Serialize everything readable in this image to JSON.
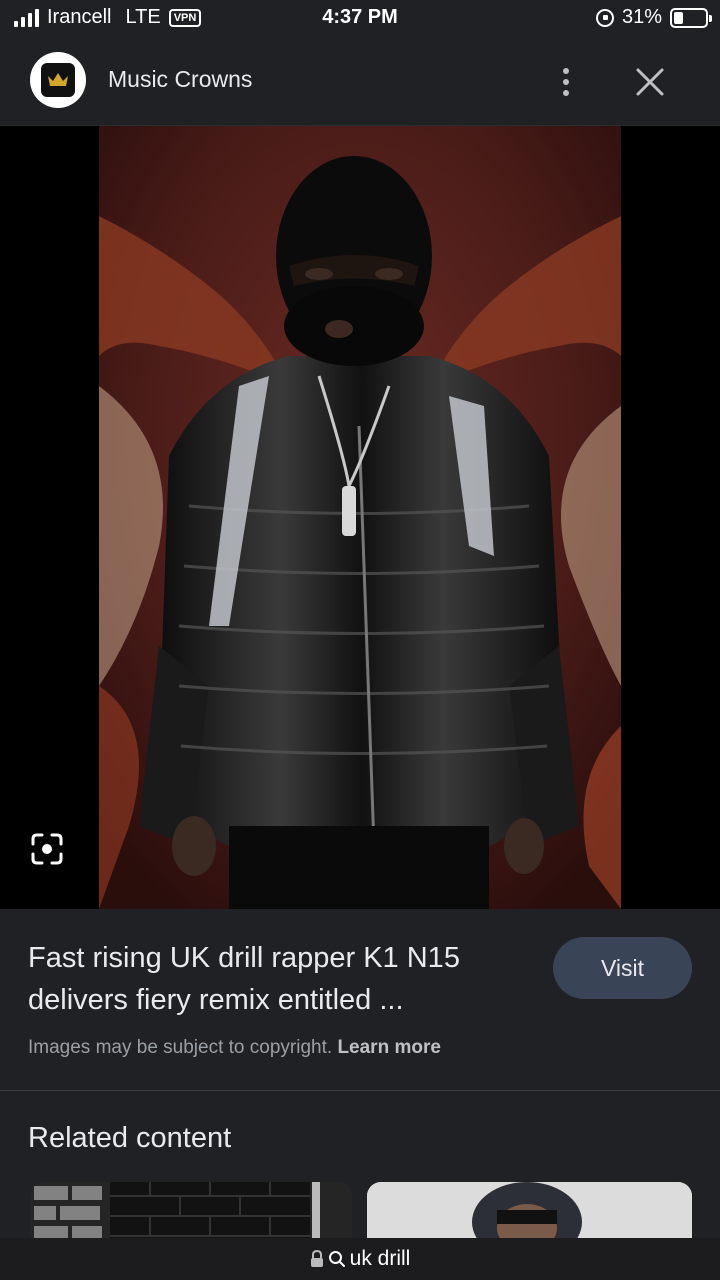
{
  "status_bar": {
    "carrier": "Irancell",
    "network": "LTE",
    "vpn": "VPN",
    "time": "4:37 PM",
    "battery": "31%",
    "battery_level": 0.31
  },
  "header": {
    "site_name": "Music Crowns",
    "logo_icon": "crown-icon"
  },
  "image": {
    "description_icon": "lens-search-icon"
  },
  "caption": {
    "title": "Fast rising UK drill rapper K1 N15 delivers fiery remix entitled ...",
    "visit_label": "Visit",
    "copyright_text": "Images may be subject to copyright.",
    "learn_more": "Learn more"
  },
  "related": {
    "title": "Related content"
  },
  "url_bar": {
    "query": "uk drill"
  },
  "colors": {
    "background": "#202124",
    "visit_button": "#394457",
    "text_primary": "#e8eaed",
    "text_secondary": "#9aa0a6"
  }
}
